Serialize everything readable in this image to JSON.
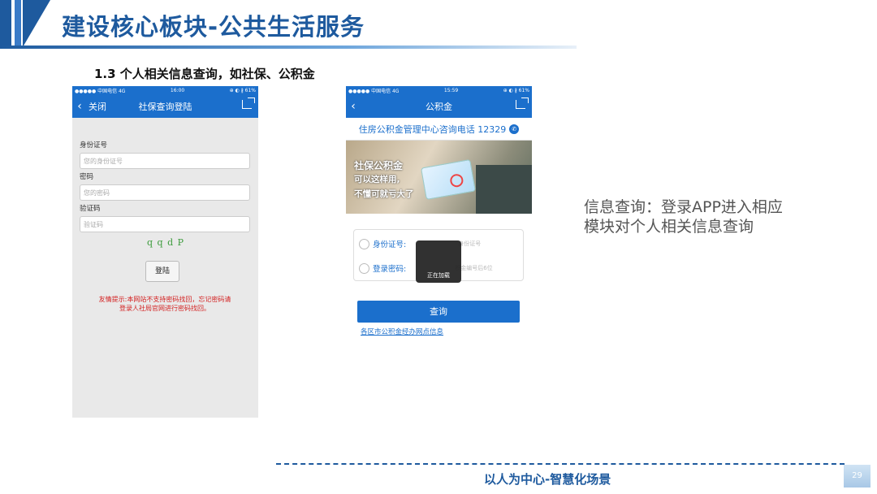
{
  "header": {
    "title": "建设核心板块-公共生活服务"
  },
  "section_title": "1.3 个人相关信息查询，如社保、公积金",
  "phone1": {
    "status_left": "●●●●● 中国电信  4G",
    "status_time": "16:00",
    "status_right": "⊕ ◐ ∦ 61%",
    "nav_close": "关闭",
    "nav_title": "社保查询登陆",
    "id_label": "身份证号",
    "id_placeholder": "您的身份证号",
    "pwd_label": "密码",
    "pwd_placeholder": "您的密码",
    "code_label": "验证码",
    "code_placeholder": "验证码",
    "captcha": "q q d P",
    "login_button": "登陆",
    "tip": "友情提示:本网站不支持密码找回，忘记密码请登录人社局官网进行密码找回。"
  },
  "phone2": {
    "status_left": "●●●●● 中国电信  4G",
    "status_time": "15:59",
    "status_right": "⊕ ◐ ∦ 61%",
    "nav_title": "公积金",
    "hotline": "住房公积金管理中心咨询电话 12329",
    "banner_line1": "社保公积金",
    "banner_line2": "可以这样用,",
    "banner_line3": "不懂可就亏大了",
    "id_label": "身份证号:",
    "id_placeholder": "身份证号",
    "pwd_label": "登录密码:",
    "pwd_placeholder": "积金编号后6位",
    "loading": "正在加载",
    "query_button": "查询",
    "link": "各区市公积金经办网点信息"
  },
  "description": "信息查询：登录APP进入相应模块对个人相关信息查询",
  "footer": {
    "text": "以人为中心-智慧化场景",
    "page": "29"
  },
  "colors": {
    "brand": "#1e5a9e",
    "app_blue": "#1b6fcc",
    "tip_red": "#d32020"
  }
}
